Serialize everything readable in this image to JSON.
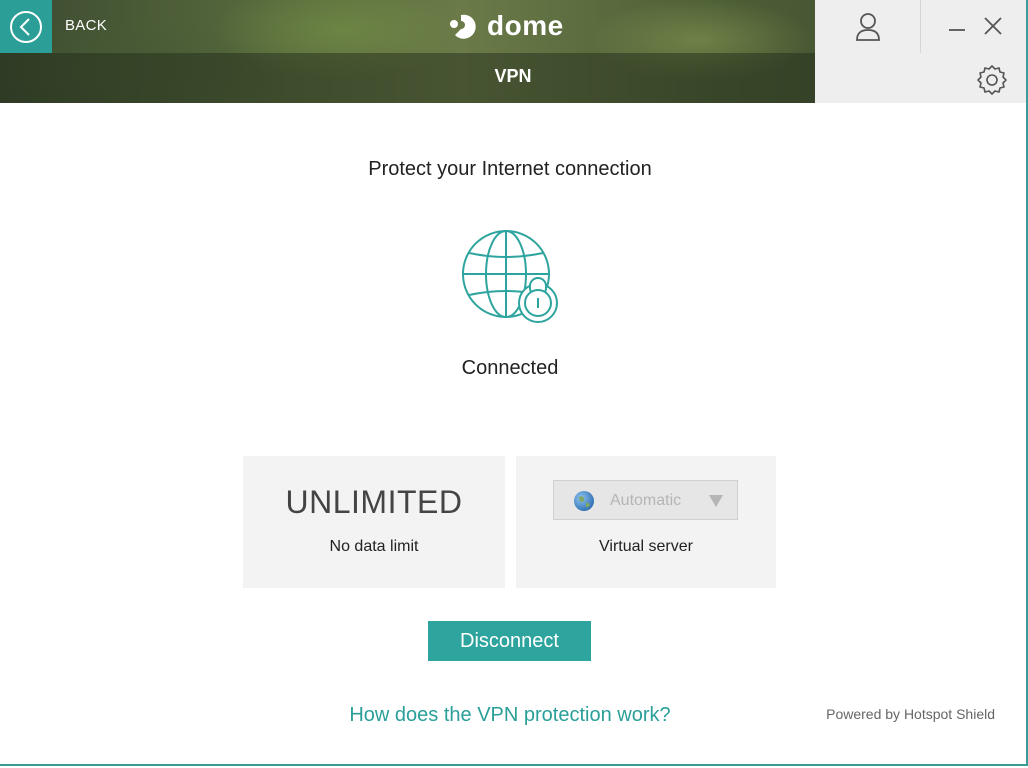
{
  "header": {
    "back_label": "BACK",
    "logo_text": "dome",
    "title": "VPN"
  },
  "main": {
    "headline": "Protect your Internet connection",
    "status": "Connected",
    "data_card": {
      "value": "UNLIMITED",
      "caption": "No data limit"
    },
    "server_card": {
      "selected": "Automatic",
      "caption": "Virtual server"
    },
    "disconnect_label": "Disconnect",
    "help_link": "How does the VPN protection work?",
    "powered_by": "Powered by Hotspot Shield"
  },
  "icons": {
    "back": "chevron-left-icon",
    "user": "user-icon",
    "minimize": "minimize-icon",
    "close": "close-icon",
    "settings": "gear-icon",
    "globe": "globe-lock-icon",
    "server": "planet-icon",
    "dropdown": "caret-down-icon"
  },
  "colors": {
    "accent": "#2ea49f",
    "link": "#2a9f99",
    "card_bg": "#f3f3f3"
  }
}
